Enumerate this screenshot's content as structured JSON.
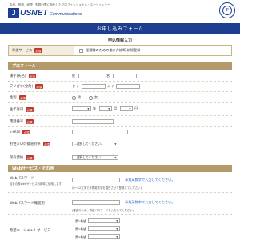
{
  "header": {
    "tagline": "会計、税務、経理・財務分野に特化したプロフェッショナル・エージェンシー",
    "logo_mark": "J",
    "logo_name": "USNET",
    "logo_sub": "Communications",
    "seal_text": "P"
  },
  "titlebar": {
    "title": "お申し込みフォーム"
  },
  "form": {
    "subtitle": "申込情報入力",
    "required_badge": "必須",
    "service": {
      "label": "希望サービス",
      "value": "経理職のための働き方診断 新規登録"
    },
    "section_profile": "プロフィール",
    "name": {
      "label": "漢字(氏名)",
      "sei": "姓",
      "mei": "名"
    },
    "kana": {
      "label": "フリガナ(全角)",
      "sei": "セイ",
      "mei": "メイ"
    },
    "gender": {
      "label": "性別",
      "male": "男",
      "female": "女"
    },
    "birth": {
      "label": "生年月日",
      "year_placeholder": "--",
      "month_placeholder": "--",
      "day_placeholder": "--",
      "year_unit": "年",
      "month_unit": "月",
      "day_unit": "日"
    },
    "phone": {
      "label": "電話番号"
    },
    "email": {
      "label": "E-mail"
    },
    "prefecture": {
      "label": "お住まいの都道府県",
      "placeholder": "--選択してください--"
    },
    "qualification": {
      "label": "保有資格",
      "placeholder": "--選択してください--"
    },
    "section_web": "Webサービス・その他",
    "password": {
      "label": "Webパスワード",
      "desc1": "当社の各Webサービス利用時に使用します。",
      "note": "半角英数字で入力してください。",
      "hint": "(8〜12文字で半角英数字を混在させて登録してください)"
    },
    "password_confirm": {
      "label": "Webパスワード確認用",
      "note": "半角英数字で入力してください。",
      "hint": "(確認のため、再度パスワードを入力してください)"
    },
    "agent_service": {
      "label": "希望エージェントサービス",
      "choices": [
        "第1希望",
        "第2希望",
        "第3希望"
      ]
    }
  }
}
